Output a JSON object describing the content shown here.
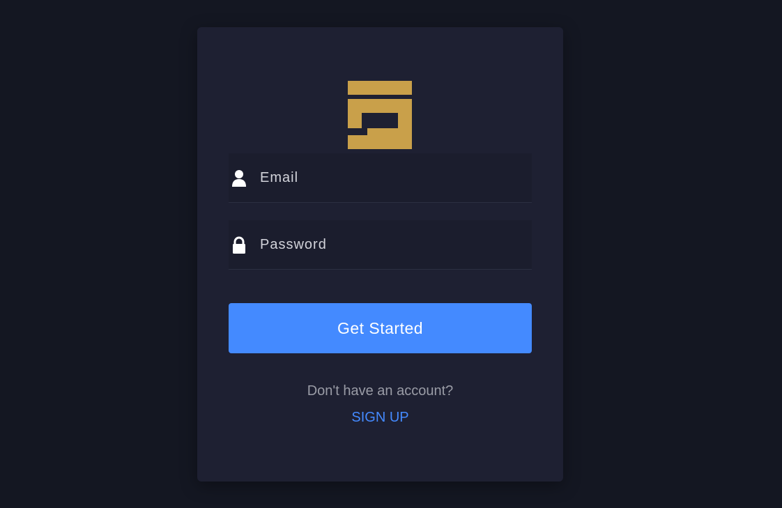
{
  "login": {
    "email": {
      "placeholder": "Email",
      "value": "",
      "icon": "user-icon"
    },
    "password": {
      "placeholder": "Password",
      "value": "",
      "icon": "lock-icon"
    },
    "submit_label": "Get Started",
    "signup_prompt": "Don't have an account?",
    "signup_link": "SIGN UP"
  },
  "colors": {
    "page_background": "#141722",
    "card_background": "#1e2032",
    "accent": "#448aff",
    "logo_gold": "#c9a04a"
  }
}
